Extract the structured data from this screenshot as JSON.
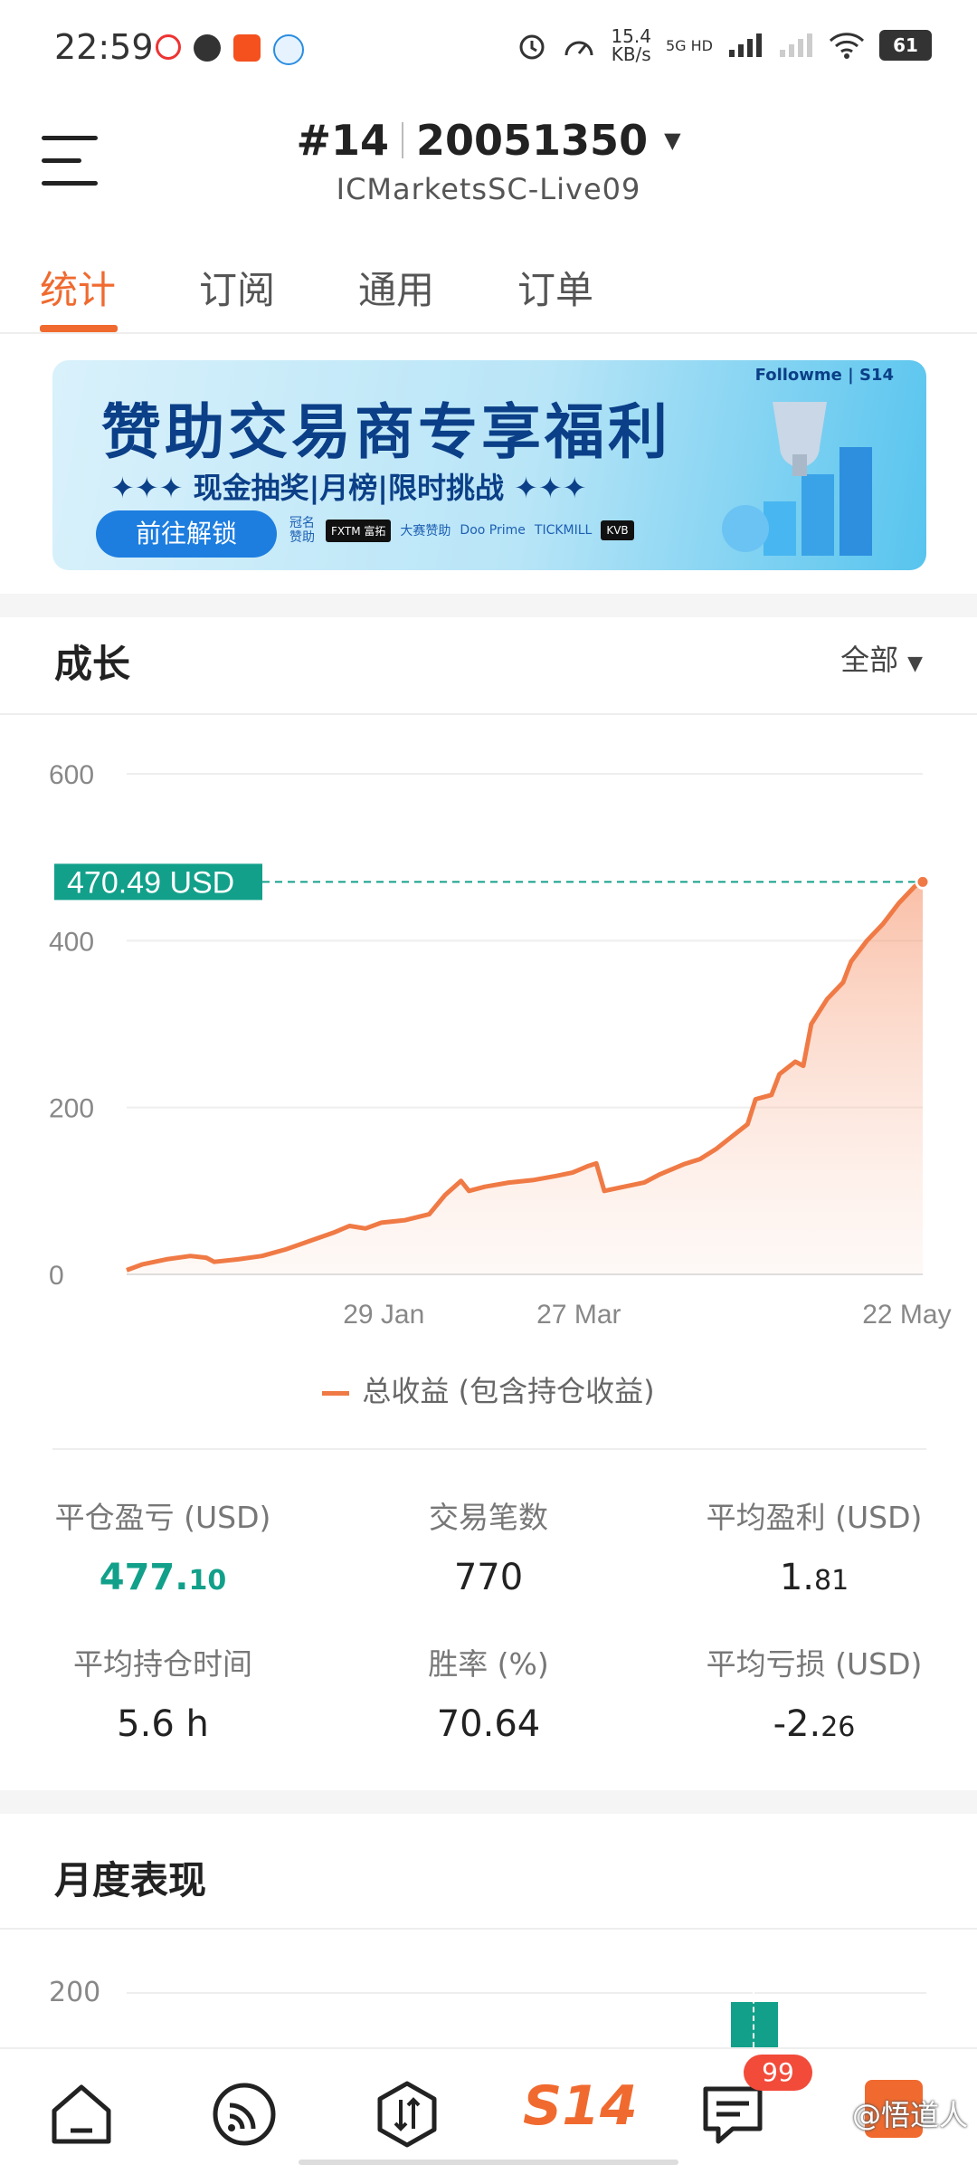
{
  "status_bar": {
    "time": "22:59",
    "net_speed": "15.4\nKB/s",
    "net_type": "5G HD",
    "battery": "61"
  },
  "header": {
    "rank": "#14",
    "account": "20051350",
    "server": "ICMarketsSC-Live09"
  },
  "tabs": [
    "统计",
    "订阅",
    "通用",
    "订单"
  ],
  "banner": {
    "title": "赞助交易商专享福利",
    "subtitle": "✦✦✦ 现金抽奖|月榜|限时挑战 ✦✦✦",
    "button": "前往解锁",
    "brand": "Followme | S14",
    "sponsor_label": "冠名赞助",
    "sponsors": [
      "FXTM 富拓",
      "大赛赞助",
      "Doo Prime",
      "TICKMILL",
      "KVB"
    ]
  },
  "growth": {
    "title": "成长",
    "filter": "全部"
  },
  "chart_data": {
    "type": "area",
    "title": "",
    "series_name": "总收益 (包含持仓收益)",
    "current_label": "470.49 USD",
    "current_value": 470.49,
    "y_ticks": [
      "600",
      "400",
      "200",
      "0"
    ],
    "x_ticks": [
      "29 Jan",
      "27 Mar",
      "22 May"
    ],
    "ylim": [
      0,
      600
    ],
    "points": [
      [
        0,
        5
      ],
      [
        2,
        12
      ],
      [
        5,
        18
      ],
      [
        8,
        22
      ],
      [
        10,
        20
      ],
      [
        11,
        15
      ],
      [
        14,
        18
      ],
      [
        17,
        22
      ],
      [
        20,
        30
      ],
      [
        23,
        40
      ],
      [
        26,
        50
      ],
      [
        28,
        58
      ],
      [
        30,
        55
      ],
      [
        32,
        62
      ],
      [
        35,
        65
      ],
      [
        38,
        72
      ],
      [
        40,
        95
      ],
      [
        42,
        112
      ],
      [
        43,
        100
      ],
      [
        45,
        105
      ],
      [
        48,
        110
      ],
      [
        51,
        113
      ],
      [
        54,
        118
      ],
      [
        56,
        122
      ],
      [
        58,
        130
      ],
      [
        59,
        133
      ],
      [
        60,
        100
      ],
      [
        62,
        104
      ],
      [
        65,
        110
      ],
      [
        67,
        120
      ],
      [
        70,
        132
      ],
      [
        72,
        138
      ],
      [
        74,
        150
      ],
      [
        76,
        165
      ],
      [
        78,
        180
      ],
      [
        79,
        210
      ],
      [
        81,
        215
      ],
      [
        82,
        240
      ],
      [
        84,
        255
      ],
      [
        85,
        250
      ],
      [
        86,
        300
      ],
      [
        88,
        330
      ],
      [
        90,
        350
      ],
      [
        91,
        375
      ],
      [
        93,
        400
      ],
      [
        95,
        420
      ],
      [
        97,
        445
      ],
      [
        99,
        465
      ],
      [
        100,
        470.49
      ]
    ],
    "color": "#f07a45",
    "label_color": "#12a08a"
  },
  "stats": [
    {
      "label": "平仓盈亏 (USD)",
      "value_main": "477.",
      "value_dec": "10",
      "green": true
    },
    {
      "label": "交易笔数",
      "value_main": "770",
      "value_dec": ""
    },
    {
      "label": "平均盈利 (USD)",
      "value_main": "1.",
      "value_dec": "81"
    },
    {
      "label": "平均持仓时间",
      "value_main": "5.6 h",
      "value_dec": ""
    },
    {
      "label": "胜率 (%)",
      "value_main": "70.64",
      "value_dec": ""
    },
    {
      "label": "平均亏损 (USD)",
      "value_main": "-2.",
      "value_dec": "26"
    }
  ],
  "monthly": {
    "title": "月度表现",
    "y_tick": "200"
  },
  "bottom_nav": {
    "badge": "99",
    "watermark": "@悟道人"
  }
}
